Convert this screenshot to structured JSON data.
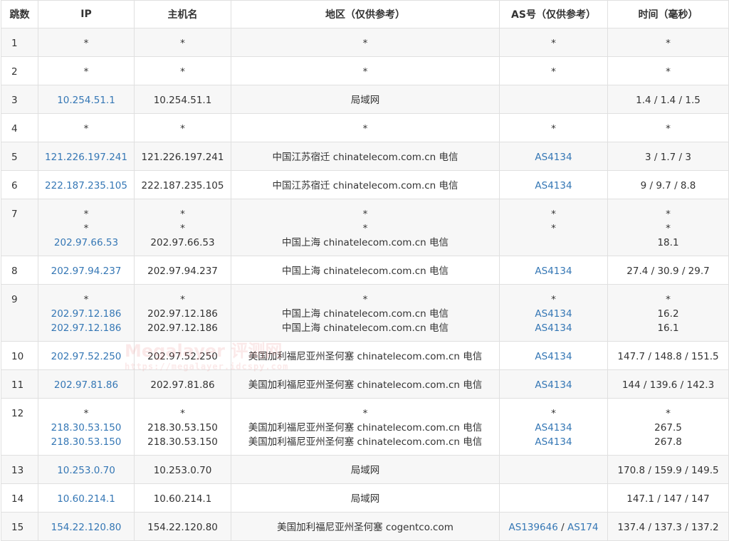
{
  "header": {
    "hop": "跳数",
    "ip": "IP",
    "host": "主机名",
    "region": "地区（仅供参考）",
    "as": "AS号（仅供参考）",
    "time": "时间（毫秒）"
  },
  "rows": [
    {
      "hop": "1",
      "lines": [
        {
          "ip": "*",
          "host": "*",
          "region": "*",
          "as": "*",
          "time": "*"
        }
      ]
    },
    {
      "hop": "2",
      "lines": [
        {
          "ip": "*",
          "host": "*",
          "region": "*",
          "as": "*",
          "time": "*"
        }
      ]
    },
    {
      "hop": "3",
      "lines": [
        {
          "ip": "10.254.51.1",
          "host": "10.254.51.1",
          "region": "局域网",
          "as": "",
          "time": "1.4 / 1.4 / 1.5"
        }
      ]
    },
    {
      "hop": "4",
      "lines": [
        {
          "ip": "*",
          "host": "*",
          "region": "*",
          "as": "*",
          "time": "*"
        }
      ]
    },
    {
      "hop": "5",
      "lines": [
        {
          "ip": "121.226.197.241",
          "host": "121.226.197.241",
          "region": "中国江苏宿迁 chinatelecom.com.cn 电信",
          "as": "AS4134",
          "time": "3 / 1.7 / 3"
        }
      ]
    },
    {
      "hop": "6",
      "lines": [
        {
          "ip": "222.187.235.105",
          "host": "222.187.235.105",
          "region": "中国江苏宿迁 chinatelecom.com.cn 电信",
          "as": "AS4134",
          "time": "9 / 9.7 / 8.8"
        }
      ]
    },
    {
      "hop": "7",
      "lines": [
        {
          "ip": "*",
          "host": "*",
          "region": "*",
          "as": "*",
          "time": "*"
        },
        {
          "ip": "*",
          "host": "*",
          "region": "*",
          "as": "*",
          "time": "*"
        },
        {
          "ip": "202.97.66.53",
          "host": "202.97.66.53",
          "region": "中国上海 chinatelecom.com.cn 电信",
          "as": "",
          "time": "18.1"
        }
      ]
    },
    {
      "hop": "8",
      "lines": [
        {
          "ip": "202.97.94.237",
          "host": "202.97.94.237",
          "region": "中国上海 chinatelecom.com.cn 电信",
          "as": "AS4134",
          "time": "27.4 / 30.9 / 29.7"
        }
      ]
    },
    {
      "hop": "9",
      "lines": [
        {
          "ip": "*",
          "host": "*",
          "region": "*",
          "as": "*",
          "time": "*"
        },
        {
          "ip": "202.97.12.186",
          "host": "202.97.12.186",
          "region": "中国上海 chinatelecom.com.cn 电信",
          "as": "AS4134",
          "time": "16.2"
        },
        {
          "ip": "202.97.12.186",
          "host": "202.97.12.186",
          "region": "中国上海 chinatelecom.com.cn 电信",
          "as": "AS4134",
          "time": "16.1"
        }
      ]
    },
    {
      "hop": "10",
      "lines": [
        {
          "ip": "202.97.52.250",
          "host": "202.97.52.250",
          "region": "美国加利福尼亚州圣何塞 chinatelecom.com.cn 电信",
          "as": "AS4134",
          "time": "147.7 / 148.8 / 151.5"
        }
      ]
    },
    {
      "hop": "11",
      "lines": [
        {
          "ip": "202.97.81.86",
          "host": "202.97.81.86",
          "region": "美国加利福尼亚州圣何塞 chinatelecom.com.cn 电信",
          "as": "AS4134",
          "time": "144 / 139.6 / 142.3"
        }
      ]
    },
    {
      "hop": "12",
      "lines": [
        {
          "ip": "*",
          "host": "*",
          "region": "*",
          "as": "*",
          "time": "*"
        },
        {
          "ip": "218.30.53.150",
          "host": "218.30.53.150",
          "region": "美国加利福尼亚州圣何塞 chinatelecom.com.cn 电信",
          "as": "AS4134",
          "time": "267.5"
        },
        {
          "ip": "218.30.53.150",
          "host": "218.30.53.150",
          "region": "美国加利福尼亚州圣何塞 chinatelecom.com.cn 电信",
          "as": "AS4134",
          "time": "267.8"
        }
      ]
    },
    {
      "hop": "13",
      "lines": [
        {
          "ip": "10.253.0.70",
          "host": "10.253.0.70",
          "region": "局域网",
          "as": "",
          "time": "170.8 / 159.9 / 149.5"
        }
      ]
    },
    {
      "hop": "14",
      "lines": [
        {
          "ip": "10.60.214.1",
          "host": "10.60.214.1",
          "region": "局域网",
          "as": "",
          "time": "147.1 / 147 / 147"
        }
      ]
    },
    {
      "hop": "15",
      "lines": [
        {
          "ip": "154.22.120.80",
          "host": "154.22.120.80",
          "region": "美国加利福尼亚州圣何塞 cogentco.com",
          "as": "AS139646 / AS174",
          "time": "137.4 / 137.3 / 137.2"
        }
      ]
    }
  ],
  "watermark": {
    "brand": "Megalayer 评测网",
    "url": "https://megalayer.idcspy.com"
  }
}
